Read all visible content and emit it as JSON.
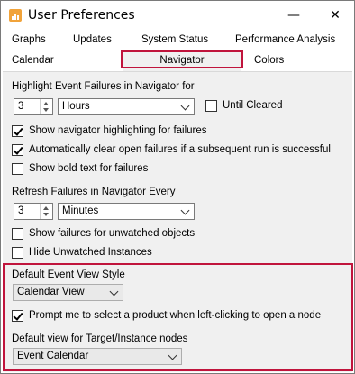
{
  "window": {
    "title": "User Preferences",
    "minimize_glyph": "—",
    "close_glyph": "✕"
  },
  "tabs": {
    "row1": [
      "Graphs",
      "Updates",
      "System Status",
      "Performance Analysis"
    ],
    "row2": [
      "Calendar",
      "Navigator",
      "Colors"
    ],
    "active": "Navigator"
  },
  "highlight": {
    "label": "Highlight Event Failures in Navigator for",
    "count": "3",
    "unit": "Hours",
    "until_cleared_label": "Until Cleared",
    "until_cleared": false
  },
  "options1": [
    {
      "label": "Show navigator highlighting for failures",
      "checked": true
    },
    {
      "label": "Automatically clear open failures if a subsequent run is successful",
      "checked": true
    },
    {
      "label": "Show bold text for failures",
      "checked": false
    }
  ],
  "refresh": {
    "label": "Refresh Failures in Navigator Every",
    "count": "3",
    "unit": "Minutes"
  },
  "options2": [
    {
      "label": "Show failures for unwatched objects",
      "checked": false
    },
    {
      "label": "Hide Unwatched Instances",
      "checked": false
    }
  ],
  "event_view": {
    "label": "Default Event View Style",
    "value": "Calendar View"
  },
  "prompt": {
    "label": "Prompt me to select a product when left-clicking to open a node",
    "checked": true
  },
  "target_view": {
    "label": "Default view for Target/Instance nodes",
    "value": "Event Calendar"
  },
  "colors": {
    "highlight_border": "#c0143c",
    "panel_bg": "#f0f0f0"
  }
}
